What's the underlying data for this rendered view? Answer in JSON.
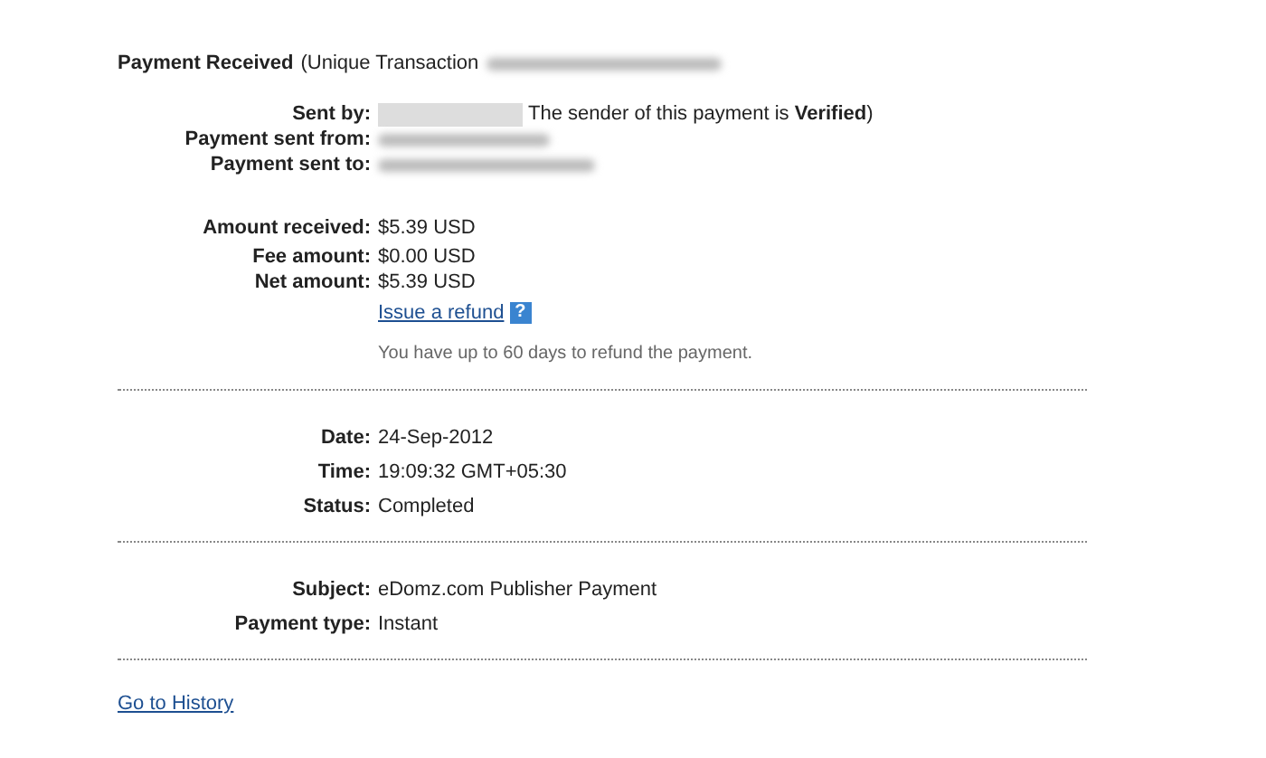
{
  "header": {
    "title": "Payment Received",
    "suffix": "(Unique Transaction",
    "redacted": true
  },
  "sections": [
    {
      "rows": [
        {
          "label": "Sent by:",
          "kind": "redacted",
          "note": "The sender of this payment is **Verified**)"
        },
        {
          "label": "Payment sent from:",
          "kind": "redacted"
        },
        {
          "label": "Payment sent to:",
          "kind": "redacted"
        }
      ]
    },
    {
      "rows": [
        {
          "label": "Amount received:",
          "kind": "text",
          "value": "$5.39 USD"
        },
        {
          "label": "Fee amount:",
          "kind": "text",
          "value": "$0.00 USD"
        },
        {
          "label": "Net amount:",
          "kind": "text",
          "value": "$5.39 USD"
        },
        {
          "kind": "link",
          "value": "Issue a refund",
          "help": "?"
        },
        {
          "kind": "note",
          "value": "You have up to 60 days to refund the payment."
        }
      ]
    },
    {
      "divider": true,
      "rows": [
        {
          "label": "Date:",
          "kind": "text",
          "value": "24-Sep-2012"
        },
        {
          "label": "Time:",
          "kind": "text",
          "value": "19:09:32 GMT+05:30"
        },
        {
          "label": "Status:",
          "kind": "text",
          "value": "Completed"
        }
      ]
    },
    {
      "divider": true,
      "rows": [
        {
          "label": "Subject:",
          "kind": "text",
          "value": "eDomz.com Publisher Payment"
        },
        {
          "label": "Payment type:",
          "kind": "text",
          "value": "Instant"
        }
      ]
    }
  ],
  "footer_divider": true,
  "history_link": "Go to History"
}
